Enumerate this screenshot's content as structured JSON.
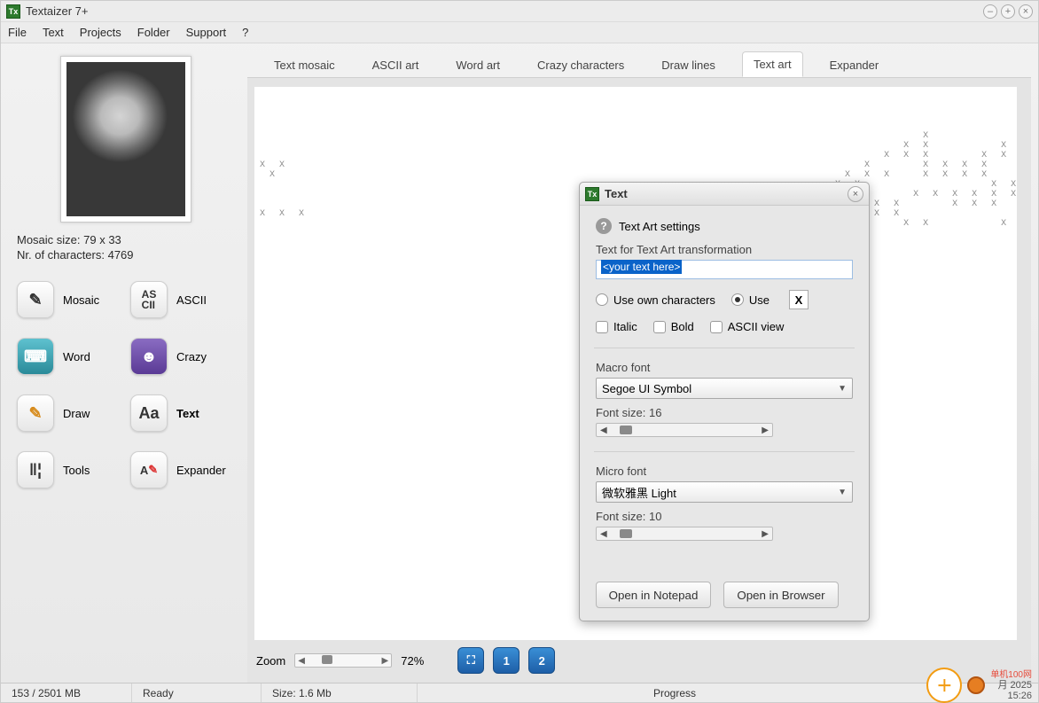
{
  "app": {
    "title": "Textaizer 7+"
  },
  "menu": {
    "file": "File",
    "text": "Text",
    "projects": "Projects",
    "folder": "Folder",
    "support": "Support",
    "help": "?"
  },
  "sidebar": {
    "mosaic_size_label": "Mosaic size: 79 x 33",
    "chars_label": "Nr. of characters: 4769",
    "tools": [
      {
        "label": "Mosaic",
        "icon": "✎"
      },
      {
        "label": "ASCII",
        "icon": "AS"
      },
      {
        "label": "Word",
        "icon": "⌨"
      },
      {
        "label": "Crazy",
        "icon": "☻"
      },
      {
        "label": "Draw",
        "icon": "✎"
      },
      {
        "label": "Text",
        "icon": "Aa"
      },
      {
        "label": "Tools",
        "icon": "‖"
      },
      {
        "label": "Expander",
        "icon": "A"
      }
    ]
  },
  "tabs": {
    "text_mosaic": "Text mosaic",
    "ascii_art": "ASCII art",
    "word_art": "Word art",
    "crazy": "Crazy characters",
    "draw_lines": "Draw lines",
    "text_art": "Text art",
    "expander": "Expander"
  },
  "dialog": {
    "title": "Text",
    "section_title": "Text Art settings",
    "text_label": "Text for Text Art transformation",
    "text_value": "<your text here>",
    "radio_own": "Use own characters",
    "radio_use": "Use",
    "char_value": "X",
    "chk_italic": "Italic",
    "chk_bold": "Bold",
    "chk_ascii": "ASCII view",
    "macro_label": "Macro font",
    "macro_value": "Segoe UI Symbol",
    "macro_size_label": "Font size: 16",
    "micro_label": "Micro font",
    "micro_value": "微软雅黑 Light",
    "micro_size_label": "Font size: 10",
    "btn_notepad": "Open in Notepad",
    "btn_browser": "Open in Browser"
  },
  "zoom": {
    "label": "Zoom",
    "percent": "72%",
    "btn_fit": "⛶",
    "btn1": "1",
    "btn2": "2"
  },
  "status": {
    "memory": "153 / 2501 MB",
    "ready": "Ready",
    "size": "Size: 1.6 Mb",
    "progress": "Progress"
  },
  "overlay": {
    "date": "月 2025",
    "time": "15:26",
    "red1": "单机100网"
  }
}
